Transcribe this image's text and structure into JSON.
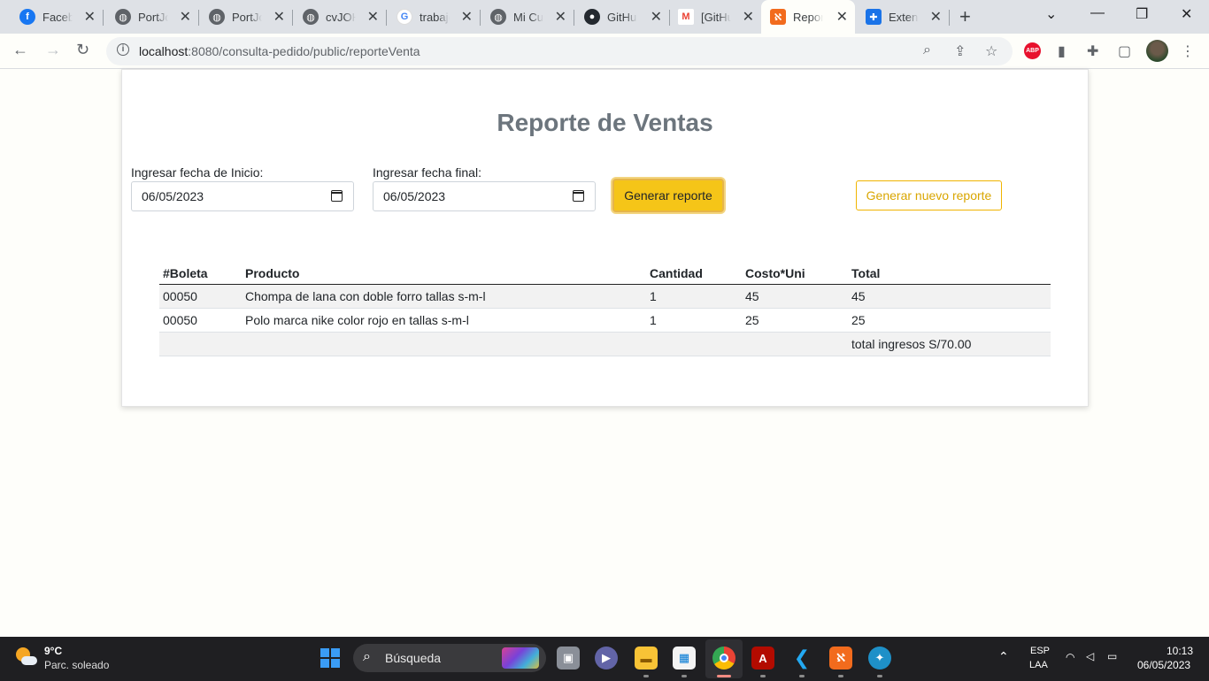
{
  "browser": {
    "tabs": [
      {
        "title": "Facebook",
        "icon": "facebook-icon",
        "active": false
      },
      {
        "title": "PortJohn",
        "icon": "globe-icon",
        "active": false
      },
      {
        "title": "PortJohn",
        "icon": "globe-icon",
        "active": false
      },
      {
        "title": "cvJOHN",
        "icon": "globe-icon",
        "active": false
      },
      {
        "title": "trabajo",
        "icon": "google-icon",
        "active": false
      },
      {
        "title": "Mi Curriculum",
        "icon": "globe-icon",
        "active": false
      },
      {
        "title": "GitHub",
        "icon": "github-icon",
        "active": false
      },
      {
        "title": "[GitHub]",
        "icon": "gmail-icon",
        "active": false
      },
      {
        "title": "Reporte",
        "icon": "xampp-icon",
        "active": true
      },
      {
        "title": "Extensiones",
        "icon": "puzzle-icon",
        "active": false
      }
    ],
    "url_host": "localhost",
    "url_rest": ":8080/consulta-pedido/public/reporteVenta",
    "abp_label": "ABP"
  },
  "page": {
    "title": "Reporte de Ventas",
    "start_label": "Ingresar fecha de Inicio:",
    "start_value": "06/05/2023",
    "end_label": "Ingresar fecha final:",
    "end_value": "06/05/2023",
    "generate_button": "Generar reporte",
    "new_report_button": "Generar nuevo reporte",
    "table": {
      "headers": [
        "#Boleta",
        "Producto",
        "Cantidad",
        "Costo*Uni",
        "Total"
      ],
      "rows": [
        [
          "00050",
          "Chompa de lana con doble forro tallas s-m-l",
          "1",
          "45",
          "45"
        ],
        [
          "00050",
          "Polo marca nike color rojo en tallas s-m-l",
          "1",
          "25",
          "25"
        ]
      ],
      "footer_total": "total ingresos S/70.00"
    }
  },
  "taskbar": {
    "weather_temp": "9°C",
    "weather_desc": "Parc. soleado",
    "search_label": "Búsqueda",
    "lang_top": "ESP",
    "lang_bottom": "LAA",
    "time": "10:13",
    "date": "06/05/2023"
  },
  "colors": {
    "accent_warning": "#f5c518",
    "outline_warning": "#f0b400",
    "title_gray": "#6c757d"
  }
}
